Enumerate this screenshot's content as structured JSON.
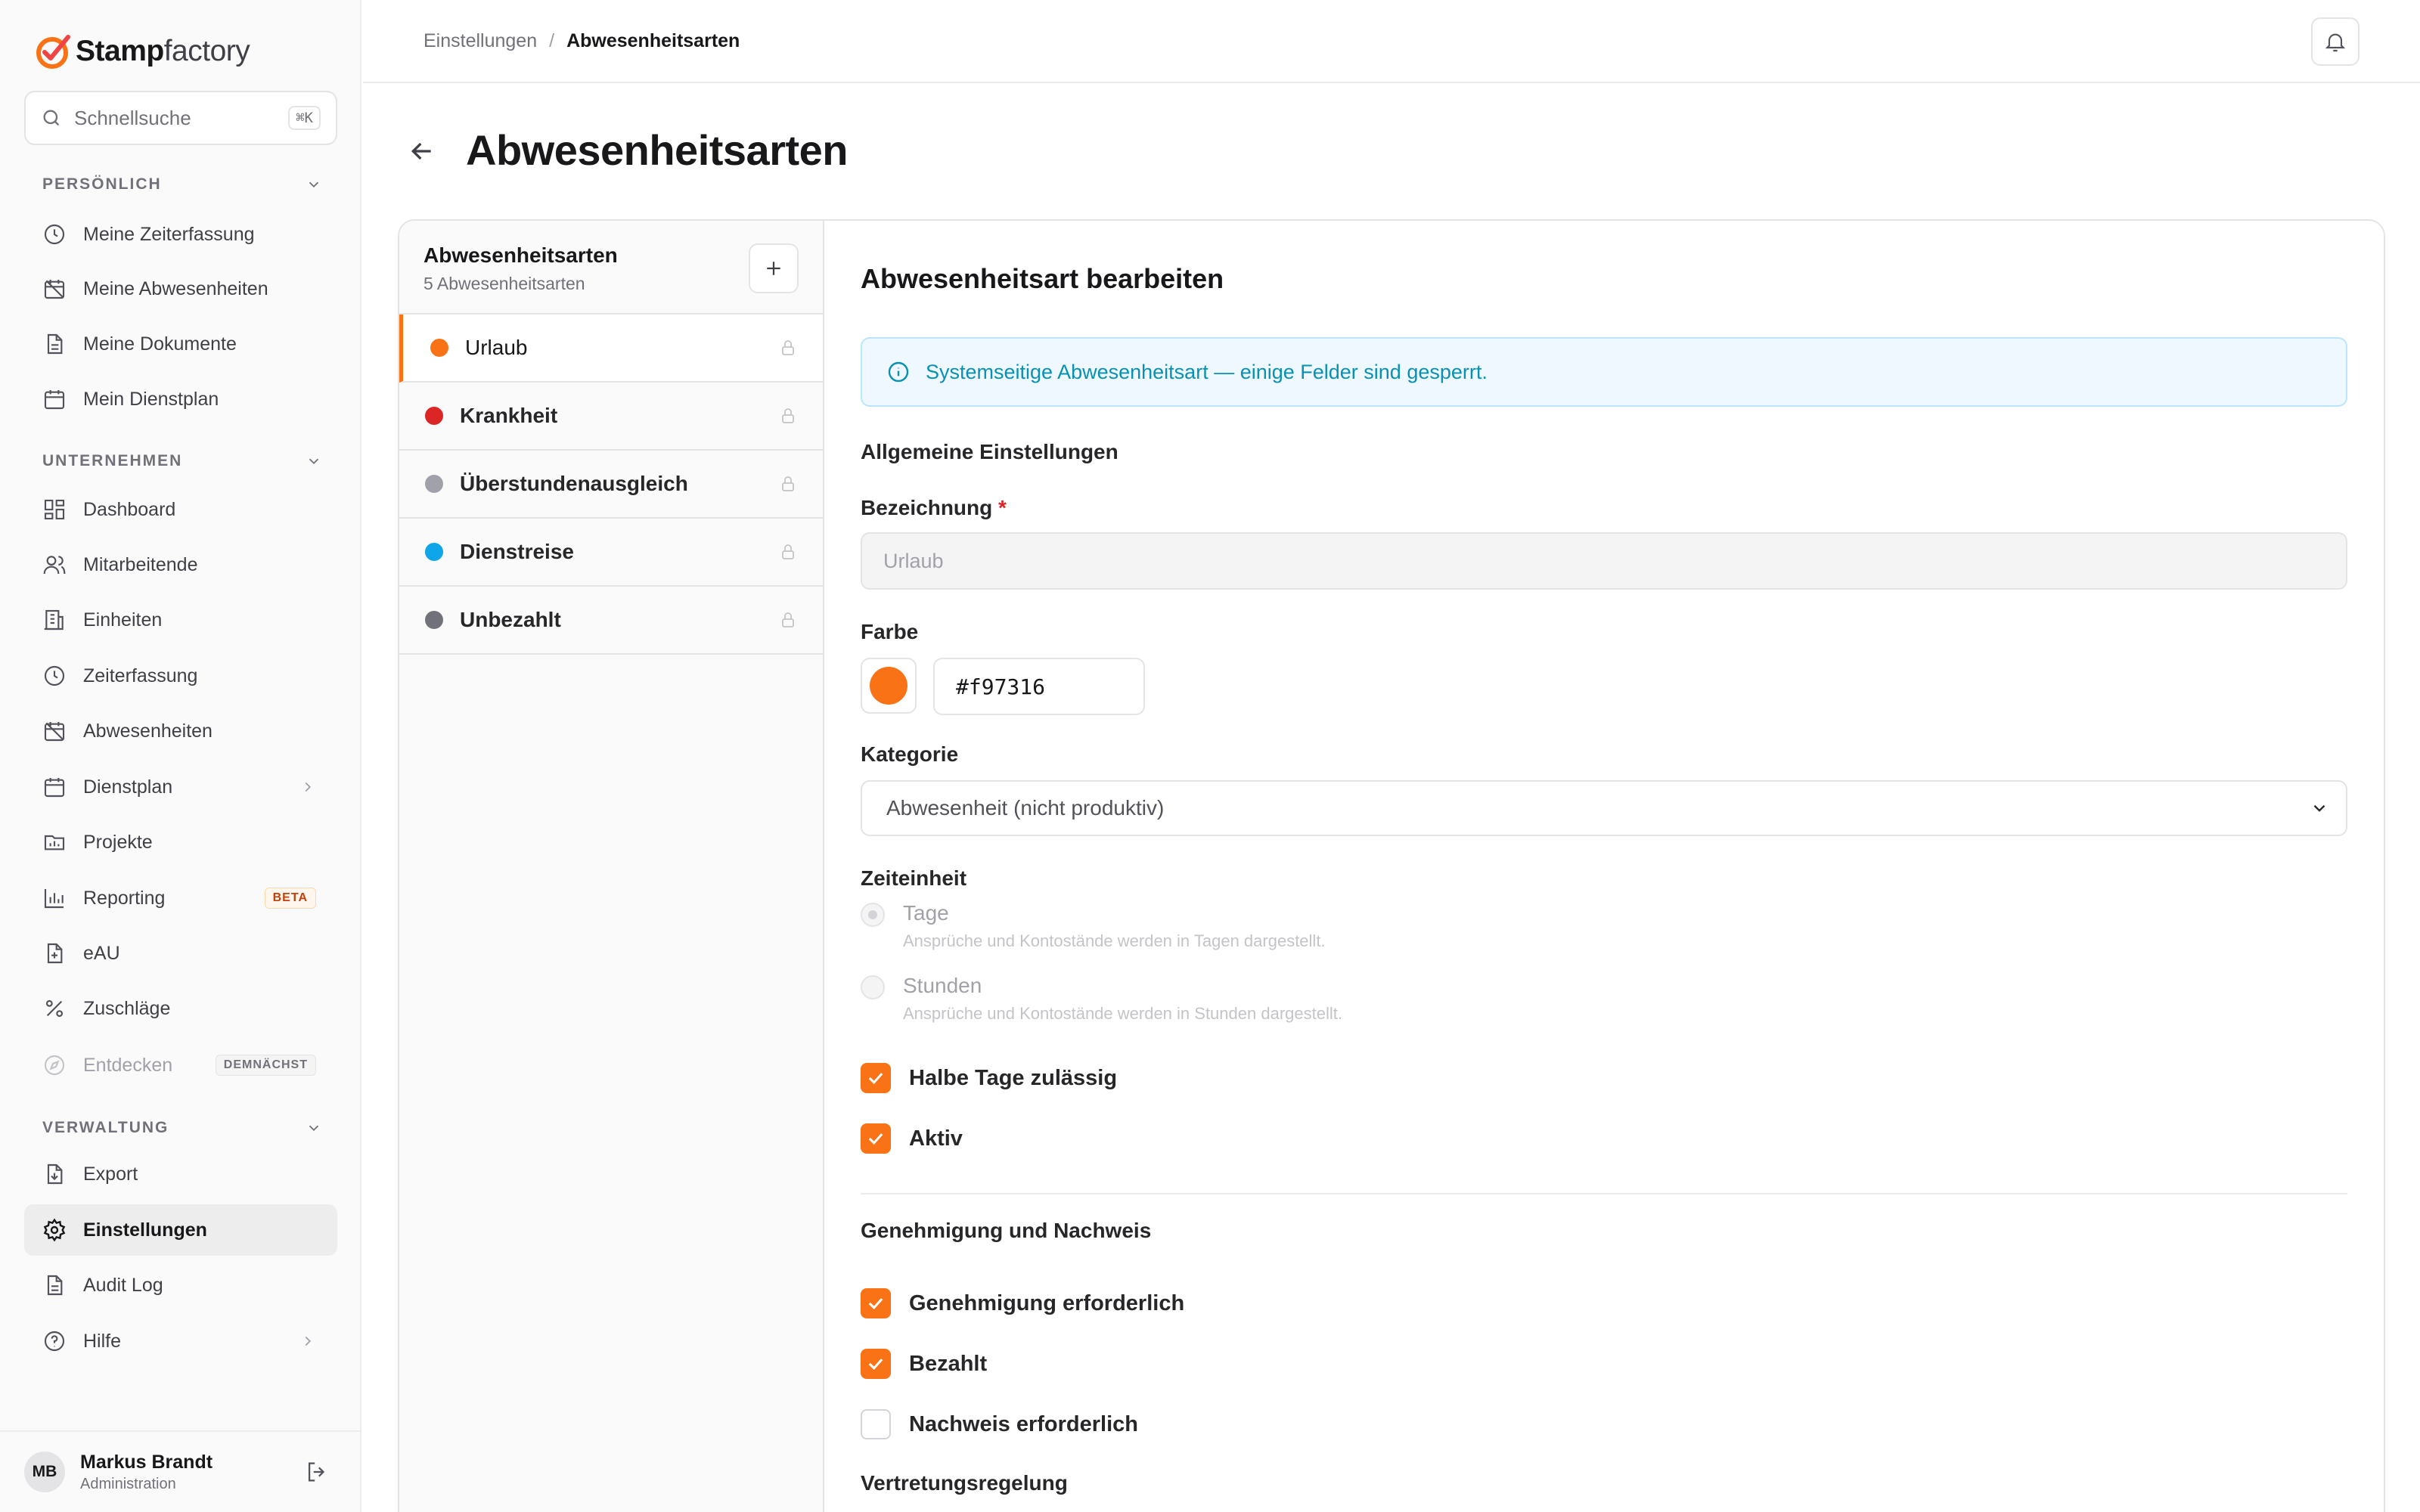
{
  "brand": {
    "name_bold": "Stamp",
    "name_light": "factory",
    "accent": "#f97316"
  },
  "search": {
    "placeholder": "Schnellsuche",
    "shortcut": "⌘K"
  },
  "sidebar": {
    "sections": {
      "personal": {
        "title": "PERSÖNLICH",
        "items": [
          {
            "label": "Meine Zeiterfassung",
            "icon": "clock-icon"
          },
          {
            "label": "Meine Abwesenheiten",
            "icon": "calendar-off-icon"
          },
          {
            "label": "Meine Dokumente",
            "icon": "document-icon"
          },
          {
            "label": "Mein Dienstplan",
            "icon": "calendar-icon"
          }
        ]
      },
      "company": {
        "title": "UNTERNEHMEN",
        "items": [
          {
            "label": "Dashboard",
            "icon": "dashboard-icon"
          },
          {
            "label": "Mitarbeitende",
            "icon": "users-icon"
          },
          {
            "label": "Einheiten",
            "icon": "building-icon"
          },
          {
            "label": "Zeiterfassung",
            "icon": "clock-icon"
          },
          {
            "label": "Abwesenheiten",
            "icon": "calendar-off-icon"
          },
          {
            "label": "Dienstplan",
            "icon": "calendar-icon"
          },
          {
            "label": "Projekte",
            "icon": "folder-icon"
          },
          {
            "label": "Reporting",
            "icon": "bar-chart-icon",
            "badge": "BETA"
          },
          {
            "label": "eAU",
            "icon": "file-medical-icon"
          },
          {
            "label": "Zuschläge",
            "icon": "percent-icon"
          },
          {
            "label": "Entdecken",
            "icon": "compass-icon",
            "badge": "DEMNÄCHST"
          }
        ]
      },
      "admin": {
        "title": "VERWALTUNG",
        "items": [
          {
            "label": "Export",
            "icon": "export-icon"
          },
          {
            "label": "Einstellungen",
            "icon": "gear-icon",
            "active": true
          },
          {
            "label": "Audit Log",
            "icon": "document-icon"
          },
          {
            "label": "Hilfe",
            "icon": "help-icon"
          }
        ]
      }
    }
  },
  "user": {
    "initials": "MB",
    "name": "Markus Brandt",
    "role": "Administration"
  },
  "breadcrumb": {
    "parent": "Einstellungen",
    "separator": "/",
    "current": "Abwesenheitsarten"
  },
  "page": {
    "title": "Abwesenheitsarten"
  },
  "list": {
    "title": "Abwesenheitsarten",
    "count": "5 Abwesenheitsarten",
    "items": [
      {
        "name": "Urlaub",
        "color": "#f97316"
      },
      {
        "name": "Krankheit",
        "color": "#dc2626"
      },
      {
        "name": "Überstundenausgleich",
        "color": "#a1a1aa"
      },
      {
        "name": "Dienstreise",
        "color": "#0ea5e9"
      },
      {
        "name": "Unbezahlt",
        "color": "#71717a"
      }
    ]
  },
  "form": {
    "title": "Abwesenheitsart bearbeiten",
    "info": "Systemseitige Abwesenheitsart — einige Felder sind gesperrt.",
    "general_heading": "Allgemeine Einstellungen",
    "name_label": "Bezeichnung",
    "required_mark": "*",
    "name_value": "Urlaub",
    "color_label": "Farbe",
    "color_value": "#f97316",
    "category_label": "Kategorie",
    "category_value": "Abwesenheit (nicht produktiv)",
    "unit_label": "Zeiteinheit",
    "unit_days": "Tage",
    "unit_days_hint": "Ansprüche und Kontostände werden in Tagen dargestellt.",
    "unit_hours": "Stunden",
    "unit_hours_hint": "Ansprüche und Kontostände werden in Stunden dargestellt.",
    "half_days": "Halbe Tage zulässig",
    "active": "Aktiv",
    "approval_heading": "Genehmigung und Nachweis",
    "approval_required": "Genehmigung erforderlich",
    "paid": "Bezahlt",
    "proof_required": "Nachweis erforderlich",
    "substitution": "Vertretungsregelung"
  }
}
